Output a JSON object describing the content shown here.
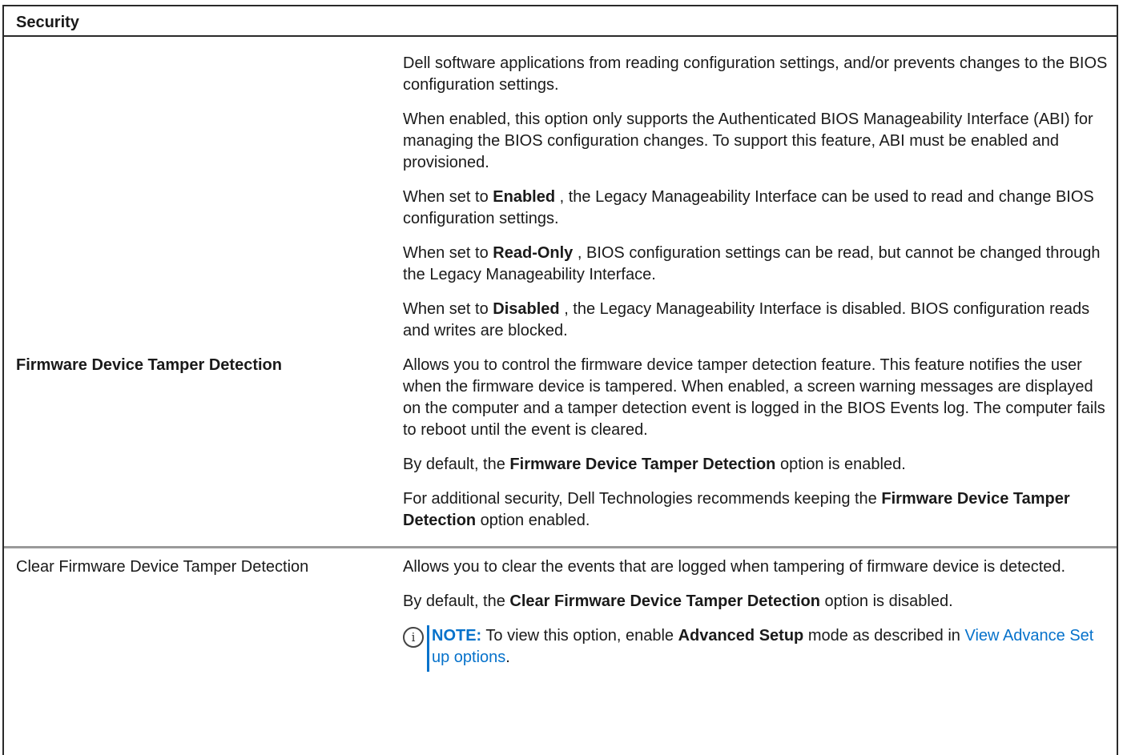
{
  "table": {
    "header": "Security",
    "row1": {
      "label": "",
      "p1": "Dell software applications from reading configuration settings, and/or prevents changes to the BIOS configuration settings.",
      "p2": "When enabled, this option only supports the Authenticated BIOS Manageability Interface (ABI) for managing the BIOS configuration changes. To support this feature, ABI must be enabled and provisioned.",
      "p3_pre": "When set to ",
      "p3_bold": "Enabled",
      "p3_post": " , the Legacy Manageability Interface can be used to read and change BIOS configuration settings.",
      "p4_pre": "When set to ",
      "p4_bold": "Read-Only",
      "p4_post": " , BIOS configuration settings can be read, but cannot be changed through the Legacy Manageability Interface.",
      "p5_pre": "When set to ",
      "p5_bold": "Disabled",
      "p5_post": " , the Legacy Manageability Interface is disabled. BIOS configuration reads and writes are blocked."
    },
    "row2": {
      "label": "Firmware Device Tamper Detection",
      "p1": "Allows you to control the firmware device tamper detection feature. This feature notifies the user when the firmware device is tampered. When enabled, a screen warning messages are displayed on the computer and a tamper detection event is logged in the BIOS Events log. The computer fails to reboot until the event is cleared.",
      "p2_pre": "By default, the ",
      "p2_bold": "Firmware Device Tamper Detection",
      "p2_post": " option is enabled.",
      "p3_pre": "For additional security, Dell Technologies recommends keeping the ",
      "p3_bold": "Firmware Device Tamper Detection",
      "p3_post": " option enabled."
    },
    "row3": {
      "label": "Clear Firmware Device Tamper Detection",
      "p1": "Allows you to clear the events that are logged when tampering of firmware device is detected.",
      "p2_pre": "By default, the ",
      "p2_bold": "Clear Firmware Device Tamper Detection",
      "p2_post": " option is disabled.",
      "note": {
        "icon_glyph": "i",
        "title": "NOTE:",
        "text_pre": " To view this option, enable ",
        "text_bold": "Advanced Setup",
        "text_post": " mode as described in ",
        "link": "View Advance Set up options",
        "text_end": "."
      }
    }
  },
  "colors": {
    "link": "#0672cb",
    "border": "#2a2a2a",
    "row_separator": "#9a9a9a"
  }
}
